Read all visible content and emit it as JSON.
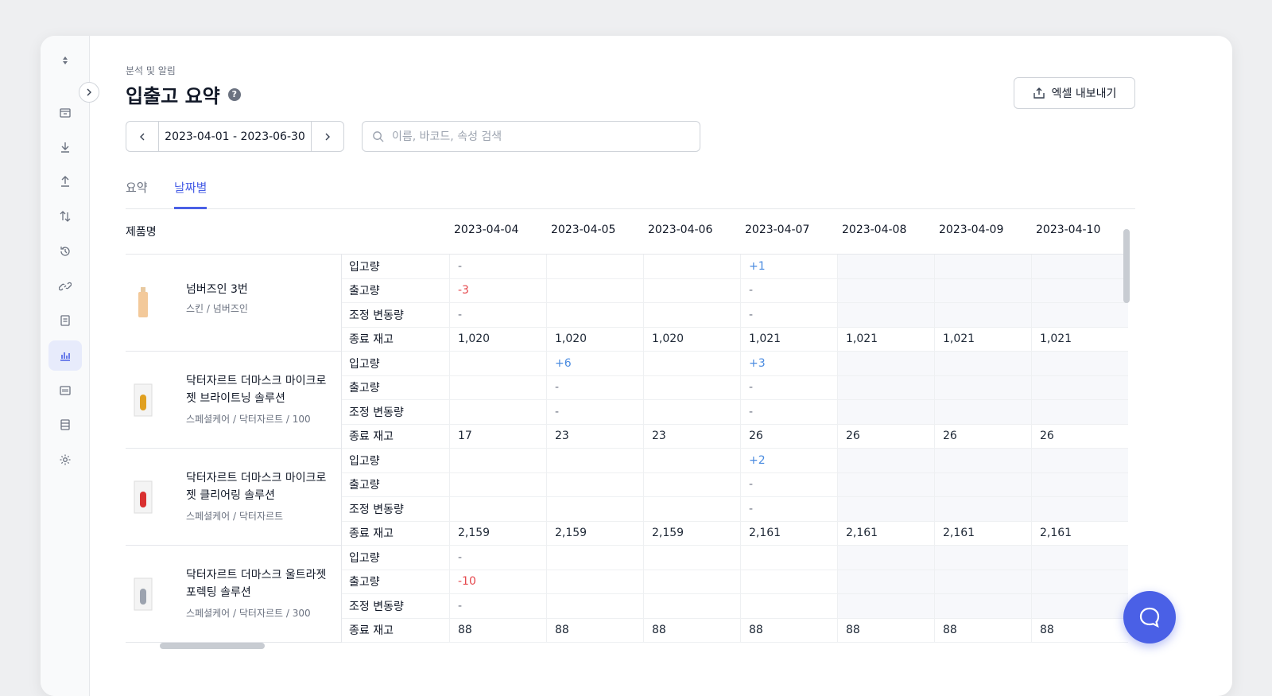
{
  "breadcrumb": "분석 및 알림",
  "title": "입출고 요약",
  "help_icon_label": "?",
  "export_label": "엑셀 내보내기",
  "date_range": "2023-04-01 - 2023-06-30",
  "search_placeholder": "이름, 바코드, 속성 검색",
  "tabs": [
    {
      "label": "요약",
      "active": false
    },
    {
      "label": "날짜별",
      "active": true
    }
  ],
  "column_product": "제품명",
  "dates": [
    "2023-04-04",
    "2023-04-05",
    "2023-04-06",
    "2023-04-07",
    "2023-04-08",
    "2023-04-09",
    "2023-04-10"
  ],
  "metrics": [
    "입고량",
    "출고량",
    "조정 변동량",
    "종료 재고"
  ],
  "colors": {
    "accent": "#4a60e6",
    "positive": "#4a8be0",
    "negative": "#e5484d"
  },
  "sidebar_icons": [
    "sort-icon",
    "box-icon",
    "download-icon",
    "upload-icon",
    "transfer-icon",
    "history-icon",
    "link-icon",
    "document-icon",
    "chart-icon",
    "barcode-icon",
    "database-icon",
    "gear-icon"
  ],
  "products": [
    {
      "name": "넘버즈인 3번",
      "category": "스킨 / 넘버즈인",
      "thumb": "bottle",
      "rows": [
        [
          "-",
          "",
          "",
          "+1",
          "",
          "",
          ""
        ],
        [
          "-3",
          "",
          "",
          "-",
          "",
          "",
          ""
        ],
        [
          "-",
          "",
          "",
          "-",
          "",
          "",
          ""
        ],
        [
          "1,020",
          "1,020",
          "1,020",
          "1,021",
          "1,021",
          "1,021",
          "1,021"
        ]
      ]
    },
    {
      "name": "닥터자르트 더마스크 마이크로 젯 브라이트닝 솔루션",
      "category": "스페셜케어 / 닥터자르트 / 100",
      "thumb": "pack-yellow",
      "rows": [
        [
          "",
          "+6",
          "",
          "+3",
          "",
          "",
          ""
        ],
        [
          "",
          "-",
          "",
          "-",
          "",
          "",
          ""
        ],
        [
          "",
          "-",
          "",
          "-",
          "",
          "",
          ""
        ],
        [
          "17",
          "23",
          "23",
          "26",
          "26",
          "26",
          "26"
        ]
      ]
    },
    {
      "name": "닥터자르트 더마스크 마이크로 젯 클리어링 솔루션",
      "category": "스페셜케어 / 닥터자르트",
      "thumb": "pack-red",
      "rows": [
        [
          "",
          "",
          "",
          "+2",
          "",
          "",
          ""
        ],
        [
          "",
          "",
          "",
          "-",
          "",
          "",
          ""
        ],
        [
          "",
          "",
          "",
          "-",
          "",
          "",
          ""
        ],
        [
          "2,159",
          "2,159",
          "2,159",
          "2,161",
          "2,161",
          "2,161",
          "2,161"
        ]
      ]
    },
    {
      "name": "닥터자르트 더마스크 울트라젯 포렉팅 솔루션",
      "category": "스페셜케어 / 닥터자르트 / 300",
      "thumb": "pack-gray",
      "rows": [
        [
          "-",
          "",
          "",
          "",
          "",
          "",
          ""
        ],
        [
          "-10",
          "",
          "",
          "",
          "",
          "",
          ""
        ],
        [
          "-",
          "",
          "",
          "",
          "",
          "",
          ""
        ],
        [
          "88",
          "88",
          "88",
          "88",
          "88",
          "88",
          "88"
        ]
      ]
    }
  ]
}
